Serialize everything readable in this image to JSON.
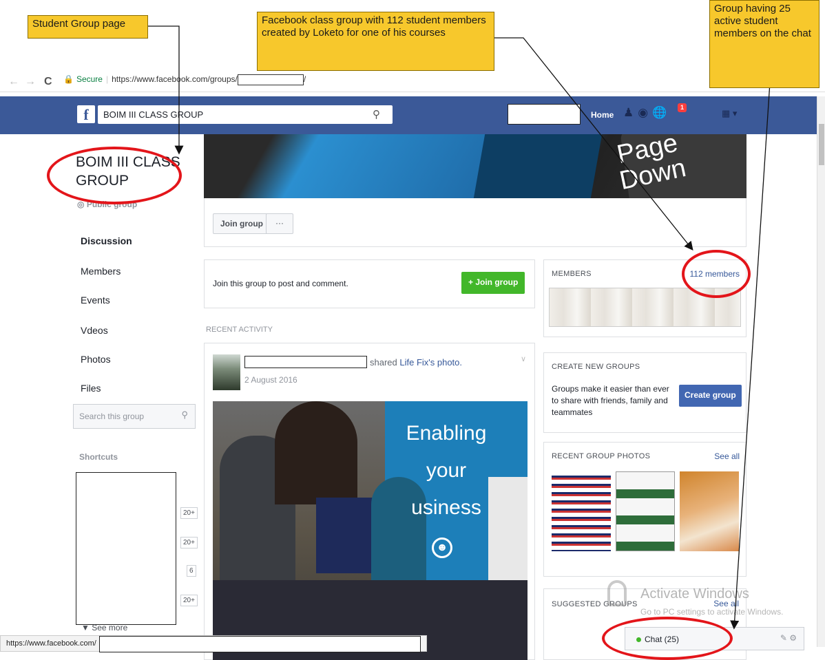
{
  "browser": {
    "secure_label": "Secure",
    "url": "https://www.facebook.com/groups/",
    "url_suffix": "/",
    "nav_back": "←",
    "nav_forward": "→",
    "nav_reload": "C"
  },
  "fb_header": {
    "logo": "f",
    "search_value": "BOIM III CLASS GROUP",
    "home": "Home",
    "notification_count": "1"
  },
  "sidebar": {
    "group_name": "BOIM III CLASS GROUP",
    "privacy": "Public group",
    "items": [
      {
        "label": "Discussion",
        "active": true
      },
      {
        "label": "Members",
        "active": false
      },
      {
        "label": "Events",
        "active": false
      },
      {
        "label": "Vdeos",
        "active": false
      },
      {
        "label": "Photos",
        "active": false
      },
      {
        "label": "Files",
        "active": false
      }
    ],
    "search_placeholder": "Search this group",
    "shortcuts_label": "Shortcuts",
    "shortcut_counts": [
      "20+",
      "20+",
      "6",
      "20+"
    ],
    "see_more": "See more"
  },
  "cover": {
    "key_text": "Page Down"
  },
  "actions": {
    "join": "Join group",
    "more": "···"
  },
  "join_prompt": {
    "text": "Join this group to post and comment.",
    "button": "+ Join group"
  },
  "recent_activity": "RECENT ACTIVITY",
  "post": {
    "action": "shared",
    "shared_link": "Life Fix's photo.",
    "date": "2 August 2016",
    "photo_text_1": "Enabling",
    "photo_text_2": "your",
    "photo_text_3": "usiness"
  },
  "members_box": {
    "title": "MEMBERS",
    "count": "112 members"
  },
  "create_box": {
    "title": "CREATE NEW GROUPS",
    "desc": "Groups make it easier than ever to share with friends, family and teammates",
    "button": "Create group"
  },
  "photos_box": {
    "title": "RECENT GROUP PHOTOS",
    "see_all": "See all"
  },
  "suggested_box": {
    "title": "SUGGESTED GROUPS",
    "see_all": "See all"
  },
  "chat": {
    "label": "Chat (25)"
  },
  "watermark": {
    "line1": "Activate Windows",
    "line2": "Go to PC settings to activate Windows."
  },
  "status_bar": {
    "url": "https://www.facebook.com/"
  },
  "callouts": {
    "student_group": "Student Group page",
    "class_group": "Facebook class group with 112 student members created by Loketo for one of his courses",
    "active_members": "Group having 25 active student members on the chat"
  },
  "colors": {
    "fb_blue": "#3b5998",
    "join_green": "#42b72a",
    "create_blue": "#4267b2",
    "callout_yellow": "#f7c82c",
    "annotation_red": "#e3151a"
  }
}
